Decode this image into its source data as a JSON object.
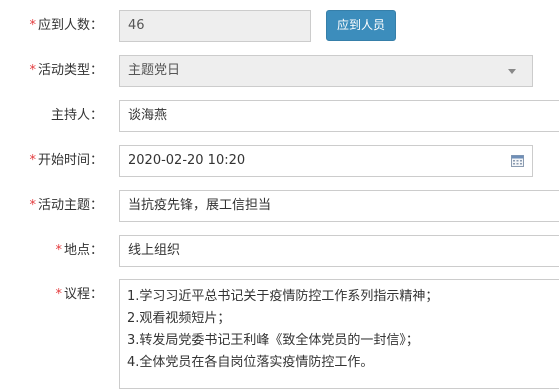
{
  "form": {
    "attendees": {
      "label": "应到人数：",
      "required": "*",
      "value": "46",
      "button_label": "应到人员"
    },
    "activity_type": {
      "label": "活动类型：",
      "required": "*",
      "value": "主题党日"
    },
    "host": {
      "label": "主持人：",
      "value": "谈海燕"
    },
    "start_time": {
      "label": "开始时间：",
      "required": "*",
      "value": "2020-02-20 10:20"
    },
    "theme": {
      "label": "活动主题：",
      "required": "*",
      "value": "当抗疫先锋，展工信担当"
    },
    "location": {
      "label": "地点：",
      "required": "*",
      "value": "线上组织"
    },
    "agenda": {
      "label": "议程：",
      "required": "*",
      "lines": [
        "1.学习习近平总书记关于疫情防控工作系列指示精神；",
        "2.观看视频短片；",
        "3.转发局党委书记王利峰《致全体党员的一封信》；",
        "4.全体党员在各自岗位落实疫情防控工作。"
      ]
    }
  },
  "colors": {
    "required_marker": "#e4393c",
    "primary_button": "#3c8dbc",
    "readonly_bg": "#eeeeee",
    "border": "#cccccc"
  },
  "icons": {
    "select_caret": "chevron-down-icon",
    "date_picker": "calendar-icon"
  }
}
